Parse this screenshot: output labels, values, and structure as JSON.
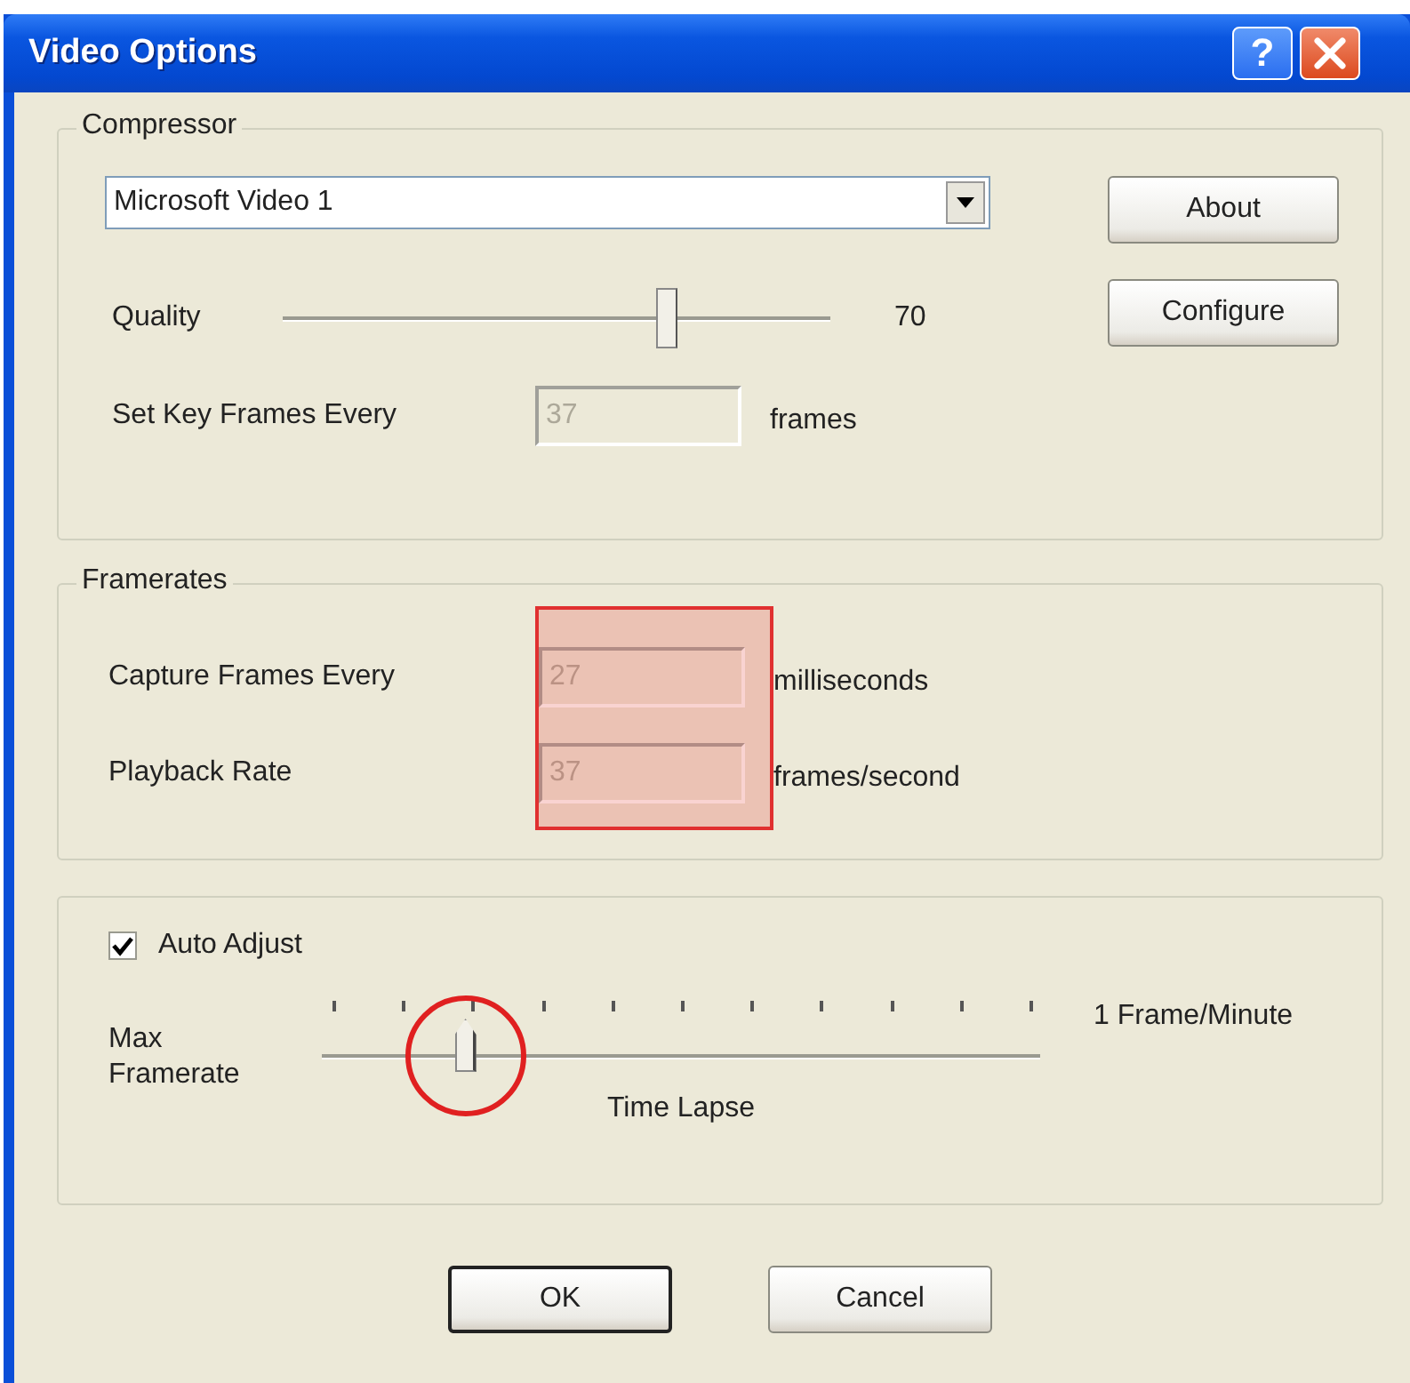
{
  "window": {
    "title": "Video Options",
    "help_button": "?"
  },
  "compressor": {
    "title": "Compressor",
    "codec": "Microsoft Video 1",
    "buttons": [
      "About",
      "Configure"
    ],
    "quality": {
      "label": "Quality",
      "level": 0.7,
      "reading": "70"
    },
    "key_frames": {
      "label": "Set Key Frames Every",
      "value": "37",
      "unit": "frames",
      "disabled": true
    }
  },
  "framerates": {
    "title": "Framerates",
    "highlighted": true,
    "rows": [
      {
        "label": "Capture Frames Every",
        "value": "27",
        "unit": "milliseconds",
        "disabled": true
      },
      {
        "label": "Playback Rate",
        "value": "37",
        "unit": "frames/second",
        "disabled": true
      }
    ]
  },
  "auto_adjust": {
    "label": "Auto Adjust",
    "checked": true
  },
  "max_framerate": {
    "label": "Max Framerate",
    "level": 0.2,
    "circled": true,
    "end_label": "1 Frame/Minute",
    "caption": "Time Lapse"
  },
  "buttons": [
    {
      "label": "OK",
      "default": true
    },
    {
      "label": "Cancel",
      "default": false
    }
  ]
}
